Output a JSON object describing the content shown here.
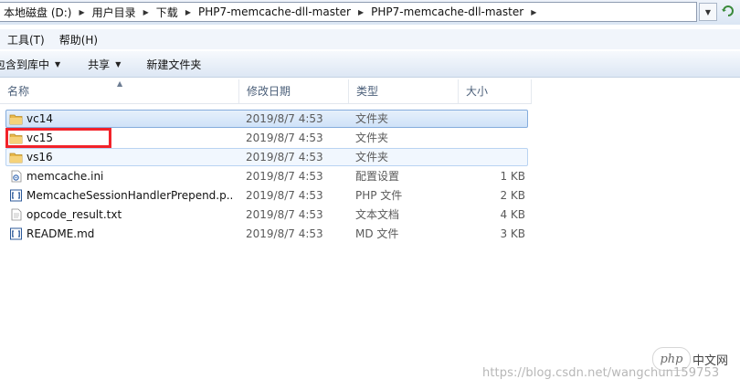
{
  "address": {
    "breadcrumbs": [
      {
        "label": "本地磁盘 (D:)"
      },
      {
        "label": "用户目录"
      },
      {
        "label": "下载"
      },
      {
        "label": "PHP7-memcache-dll-master"
      },
      {
        "label": "PHP7-memcache-dll-master"
      }
    ]
  },
  "menu": {
    "tools": "工具(T)",
    "help": "帮助(H)"
  },
  "toolbar": {
    "include_in_library": "包含到库中",
    "share": "共享",
    "new_folder": "新建文件夹"
  },
  "columns": {
    "name": "名称",
    "date": "修改日期",
    "type": "类型",
    "size": "大小"
  },
  "files": [
    {
      "name": "vc14",
      "date": "2019/8/7 4:53",
      "type": "文件夹",
      "size": "",
      "icon": "folder-icon",
      "state": "selected"
    },
    {
      "name": "vc15",
      "date": "2019/8/7 4:53",
      "type": "文件夹",
      "size": "",
      "icon": "folder-icon",
      "state": "normal"
    },
    {
      "name": "vs16",
      "date": "2019/8/7 4:53",
      "type": "文件夹",
      "size": "",
      "icon": "folder-icon",
      "state": "hovered"
    },
    {
      "name": "memcache.ini",
      "date": "2019/8/7 4:53",
      "type": "配置设置",
      "size": "1 KB",
      "icon": "config-file-icon",
      "state": "normal"
    },
    {
      "name": "MemcacheSessionHandlerPrepend.p...",
      "date": "2019/8/7 4:53",
      "type": "PHP 文件",
      "size": "2 KB",
      "icon": "code-file-icon",
      "state": "normal"
    },
    {
      "name": "opcode_result.txt",
      "date": "2019/8/7 4:53",
      "type": "文本文档",
      "size": "4 KB",
      "icon": "text-file-icon",
      "state": "normal"
    },
    {
      "name": "README.md",
      "date": "2019/8/7 4:53",
      "type": "MD 文件",
      "size": "3 KB",
      "icon": "code-file-icon",
      "state": "normal"
    }
  ],
  "watermark": {
    "logo": "php",
    "site": "中文网",
    "url": "https://blog.csdn.net/wangchun159753"
  },
  "colors": {
    "selection": "#cfe2f8",
    "selection_border": "#84acdd",
    "redaction": "#f2232a",
    "folder": "#e8b84a"
  }
}
